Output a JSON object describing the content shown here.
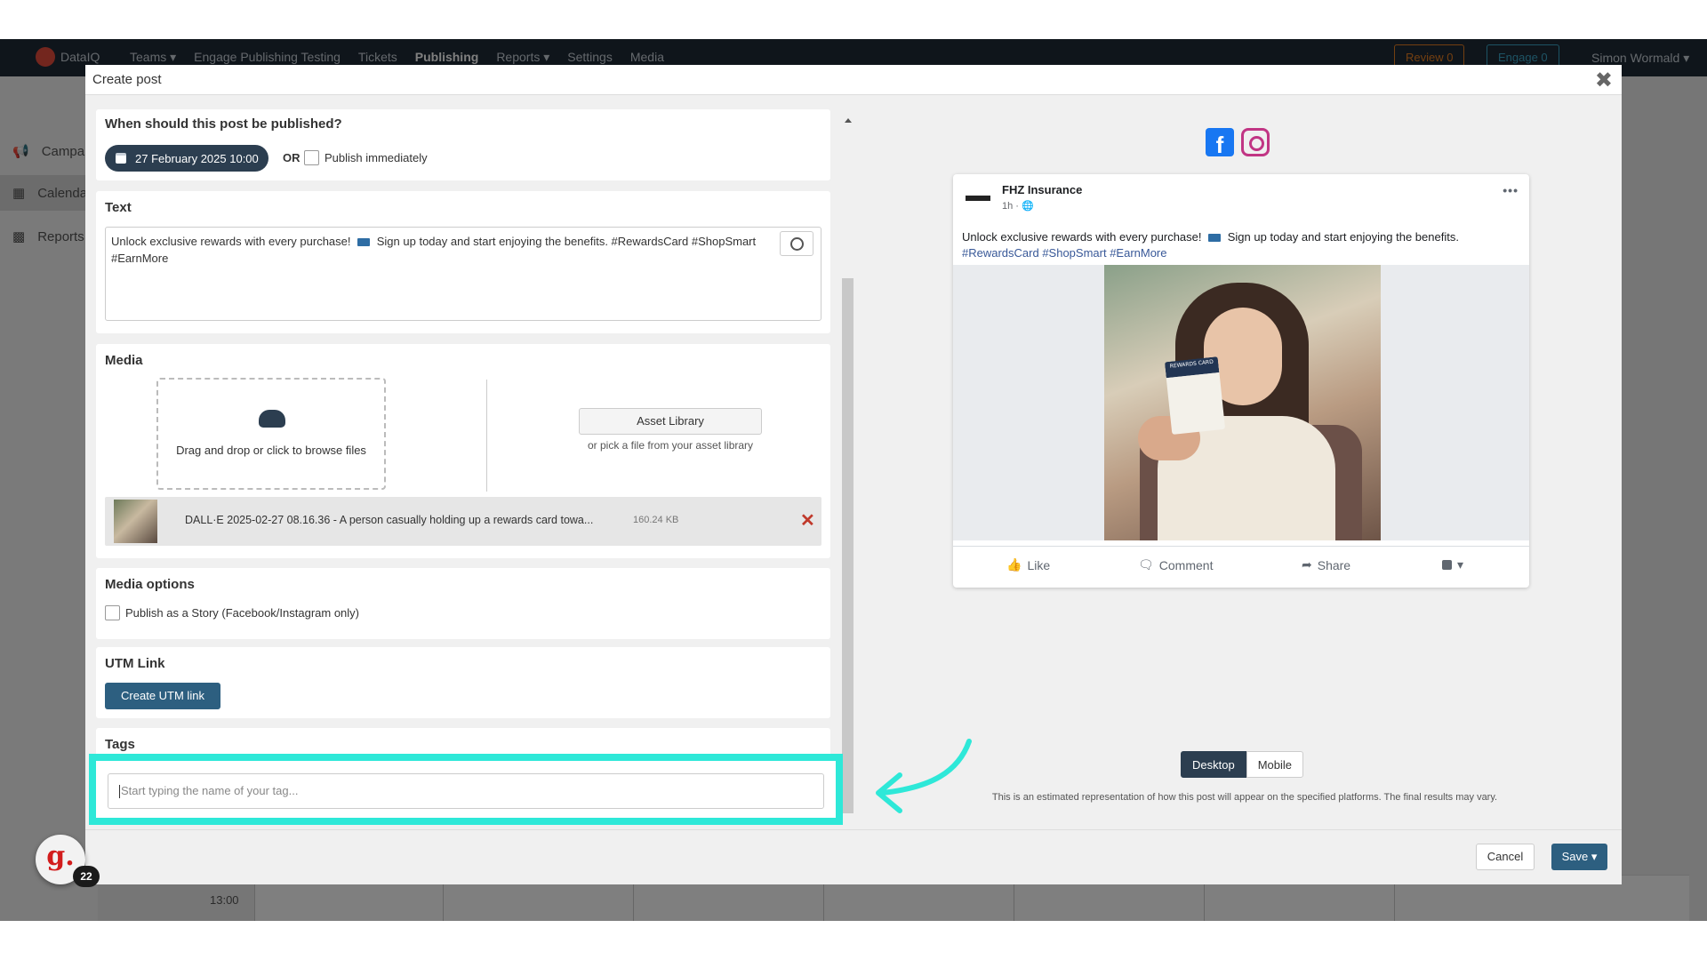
{
  "topnav": {
    "brand": "DataIQ",
    "items": [
      "Teams ▾",
      "Engage Publishing Testing",
      "Tickets",
      "Publishing",
      "Reports ▾",
      "Settings",
      "Media"
    ],
    "review_label": "Review  0",
    "engage_label": "Engage  0",
    "user_label": "Simon Wormald ▾"
  },
  "sidebar": {
    "items": [
      {
        "label": "Campaigns",
        "icon": "megaphone-icon"
      },
      {
        "label": "Calendar",
        "icon": "calendar-icon"
      },
      {
        "label": "Reports",
        "icon": "bar-chart-icon"
      }
    ]
  },
  "calendar_bg": {
    "time": "13:00"
  },
  "modal": {
    "title": "Create post",
    "close_icon": "close-icon",
    "when": {
      "title": "When should this post be published?",
      "date": "27 February 2025 10:00",
      "or": "OR",
      "publish_immediately": "Publish immediately"
    },
    "text": {
      "title": "Text",
      "body_before_emoji": "Unlock exclusive rewards with every purchase!",
      "body_after_emoji": "Sign up today and start enjoying the benefits. #RewardsCard #ShopSmart #EarnMore"
    },
    "media": {
      "title": "Media",
      "dropzone_text": "Drag and drop or click to browse files",
      "asset_button": "Asset Library",
      "asset_sub": "or pick a file from your asset library",
      "file_name": "DALL·E 2025-02-27 08.16.36 - A person casually holding up a rewards card towa...",
      "file_size": "160.24 KB"
    },
    "media_options": {
      "title": "Media options",
      "story_label": "Publish as a Story (Facebook/Instagram only)"
    },
    "utm": {
      "title": "UTM Link",
      "button": "Create UTM link"
    },
    "tags": {
      "title": "Tags",
      "placeholder": "Start typing the name of your tag..."
    },
    "preview": {
      "networks": [
        "facebook-icon",
        "instagram-icon"
      ],
      "page_name": "FHZ Insurance",
      "meta": "1h · ",
      "more": "•••",
      "text_before_emoji": "Unlock exclusive rewards with every purchase!",
      "text_after_emoji": "Sign up today and start enjoying the benefits.",
      "hashtags": "#RewardsCard #ShopSmart #EarnMore",
      "card_label": "REWARDS CARD",
      "actions": {
        "like": "Like",
        "comment": "Comment",
        "share": "Share"
      },
      "toggle": {
        "desktop": "Desktop",
        "mobile": "Mobile"
      },
      "disclaimer": "This is an estimated representation of how this post will appear on the specified platforms. The final results may vary."
    },
    "footer": {
      "cancel": "Cancel",
      "save": "Save ▾"
    }
  },
  "guide": {
    "logo": "g.",
    "badge": "22"
  },
  "colors": {
    "highlight": "#2ee8d8",
    "primary_button": "#2d5f80",
    "dark_pill": "#2c3e50",
    "remove": "#c0392b"
  }
}
